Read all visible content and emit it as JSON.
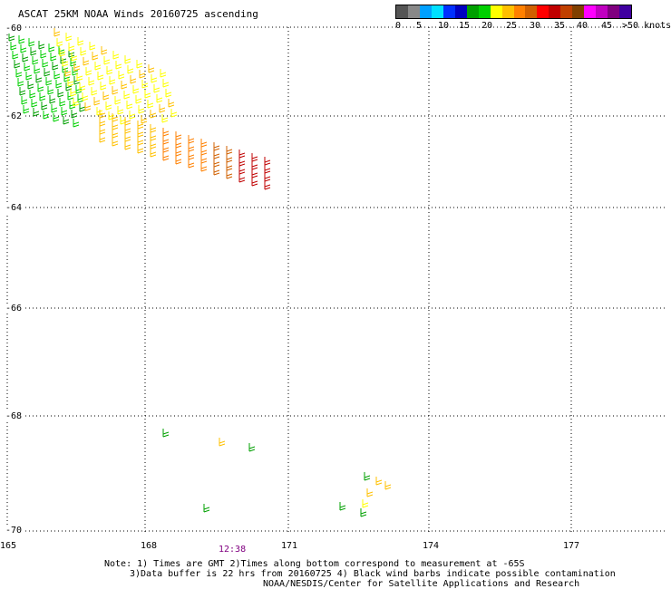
{
  "title": "ASCAT 25KM NOAA Winds 20160725 ascending",
  "legend": {
    "colors": [
      "#555555",
      "#888888",
      "#00a0ff",
      "#00e0ff",
      "#0030ff",
      "#0000c0",
      "#00a000",
      "#00d000",
      "#ffff00",
      "#ffc000",
      "#ff8000",
      "#d06000",
      "#ff0000",
      "#c00000",
      "#c04000",
      "#804000",
      "#ff00ff",
      "#c000c0",
      "#800080",
      "#4000a0"
    ],
    "labels": [
      "0",
      "5",
      "10",
      "15",
      "20",
      "25",
      "30",
      "35",
      "40",
      "45",
      ">50 knots"
    ]
  },
  "lat_labels": [
    "-60",
    "-62",
    "-64",
    "-66",
    "-68",
    "-70"
  ],
  "lon_labels": [
    "165",
    "168",
    "171",
    "174",
    "177"
  ],
  "time_label": "12:38",
  "notes": [
    "Note: 1) Times are GMT 2)Times along bottom correspond to measurement at -65S",
    "3)Data buffer is 22 hrs from 20160725 4) Black wind barbs indicate possible contamination",
    "NOAA/NESDIS/Center for Satellite Applications and Research"
  ]
}
